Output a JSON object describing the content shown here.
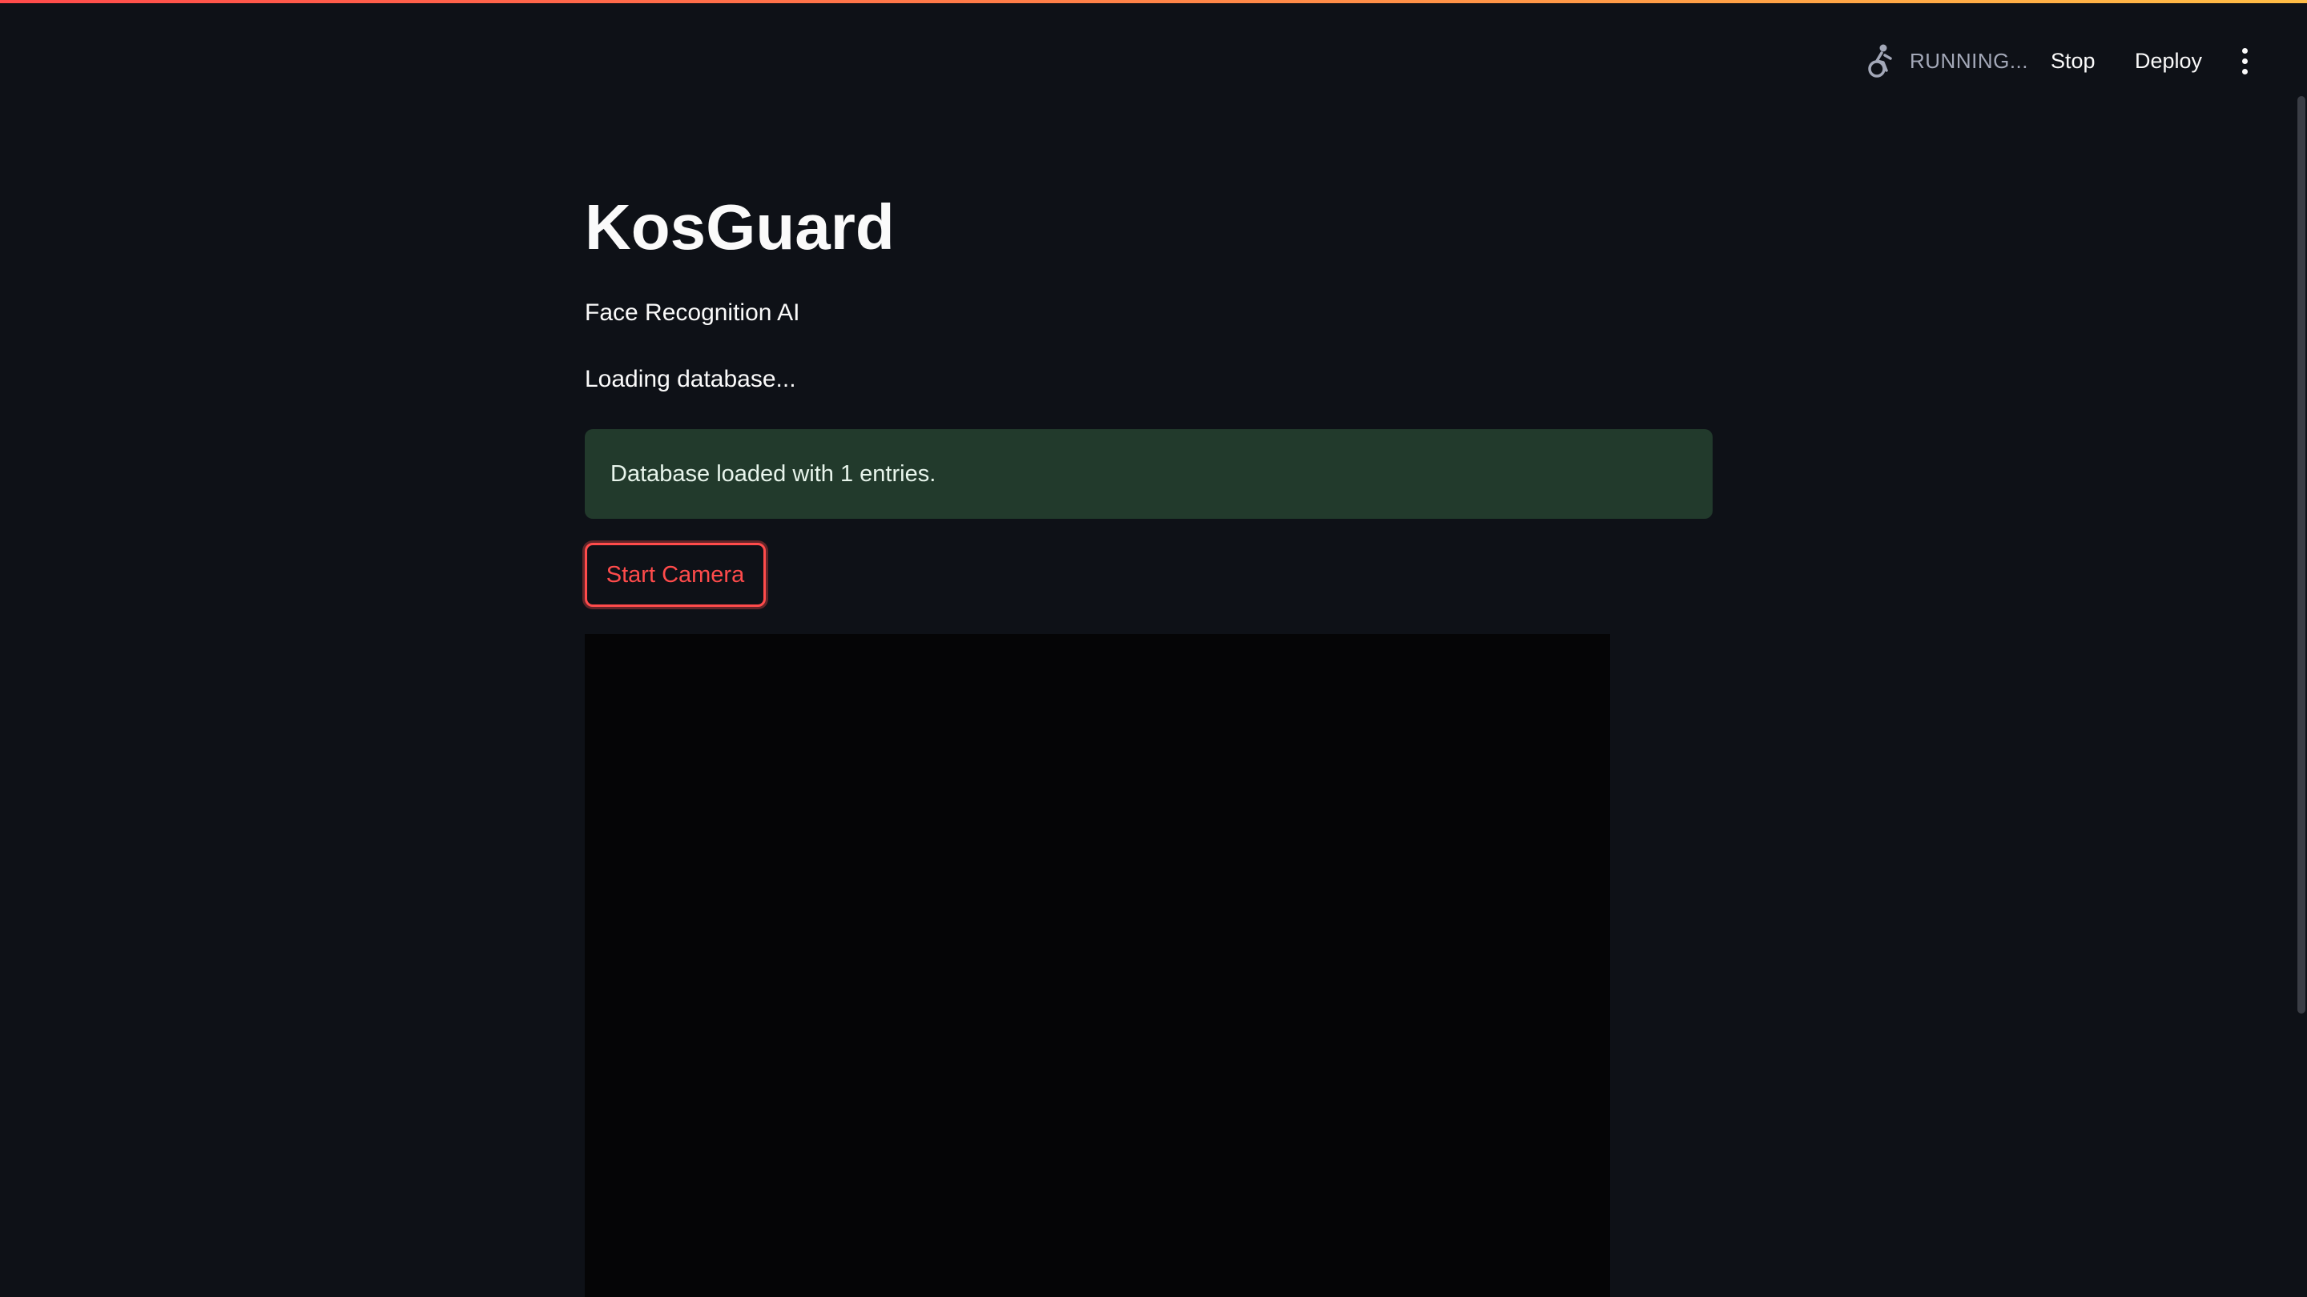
{
  "header": {
    "status": "RUNNING...",
    "stop_label": "Stop",
    "deploy_label": "Deploy",
    "status_icon": "running-figure-icon",
    "menu_icon": "more-vertical-icon"
  },
  "main": {
    "title": "KosGuard",
    "subtitle": "Face Recognition AI",
    "loading": "Loading database...",
    "success_message": "Database loaded with 1 entries.",
    "start_camera_label": "Start Camera"
  },
  "colors": {
    "background": "#0e1117",
    "accent": "#ff4b4b",
    "success_bg": "#223a2c"
  }
}
